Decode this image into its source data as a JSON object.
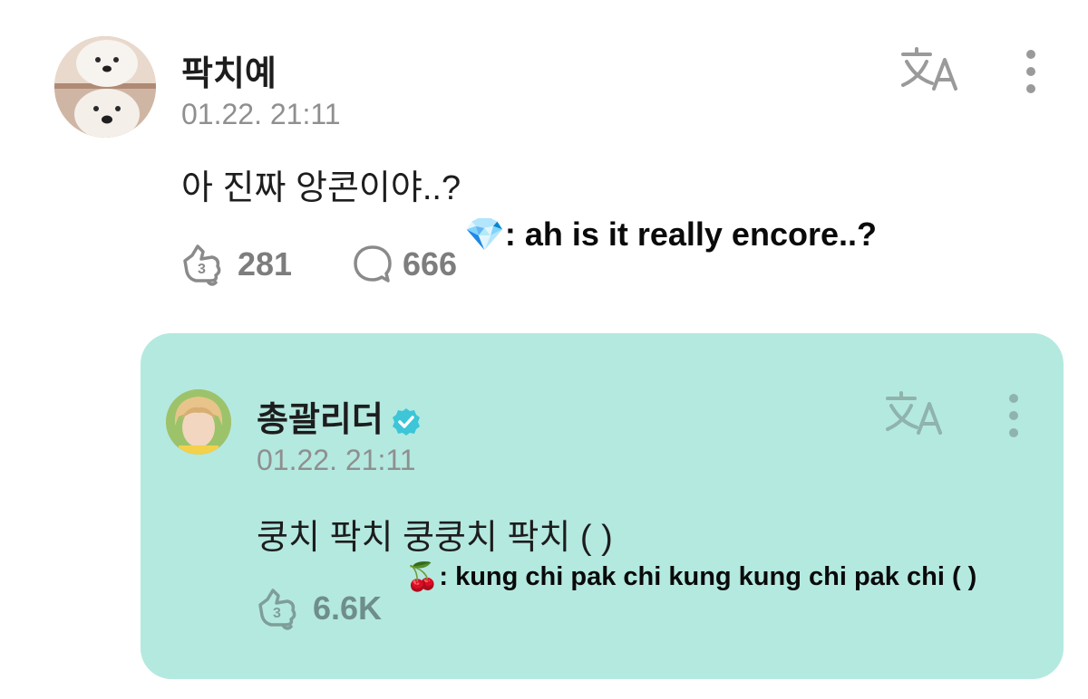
{
  "comment": {
    "author": "팍치예",
    "timestamp": "01.22. 21:11",
    "text": "아 진짜 앙콘이야..?",
    "translation": ": ah is it really encore..?",
    "translation_emoji": "💎",
    "likes": "281",
    "replies": "666",
    "icons": [
      "avatar-photo",
      "translate-icon",
      "more-vertical-icon",
      "like-icon",
      "reply-bubble-icon"
    ]
  },
  "reply": {
    "author": "총괄리더",
    "verified": true,
    "timestamp": "01.22. 21:11",
    "text": "쿵치 팍치 쿵쿵치 팍치 ( )",
    "translation": ": kung chi pak chi kung kung chi pak chi ( )",
    "translation_emoji": "🍒",
    "likes": "6.6K",
    "background": "#b4e9e0",
    "icons": [
      "avatar-photo",
      "verified-badge-icon",
      "translate-icon",
      "more-vertical-icon",
      "like-icon"
    ]
  },
  "colors": {
    "text_primary": "#1d1d1d",
    "text_secondary": "#8f8f8f",
    "verified_badge": "#3cc6d8",
    "reply_card_bg": "#b4e9e0"
  }
}
